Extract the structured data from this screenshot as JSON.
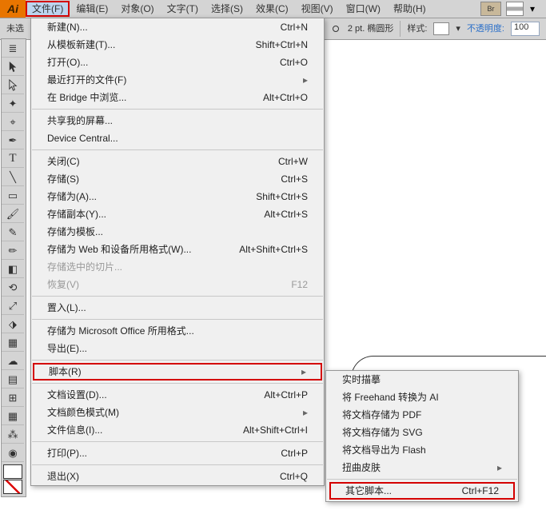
{
  "app": {
    "logo": "Ai"
  },
  "menubar": [
    "文件(F)",
    "编辑(E)",
    "对象(O)",
    "文字(T)",
    "选择(S)",
    "效果(C)",
    "视图(V)",
    "窗口(W)",
    "帮助(H)"
  ],
  "toolbar": {
    "doc_prefix": "未选",
    "stroke_label": "2 pt. 椭圆形",
    "style_label": "样式:",
    "opacity_label": "不透明度:",
    "opacity_value": "100"
  },
  "file_menu": [
    {
      "label": "新建(N)...",
      "sc": "Ctrl+N"
    },
    {
      "label": "从模板新建(T)...",
      "sc": "Shift+Ctrl+N"
    },
    {
      "label": "打开(O)...",
      "sc": "Ctrl+O"
    },
    {
      "label": "最近打开的文件(F)",
      "arrow": true
    },
    {
      "label": "在 Bridge 中浏览...",
      "sc": "Alt+Ctrl+O"
    },
    {
      "div": true
    },
    {
      "label": "共享我的屏幕..."
    },
    {
      "label": "Device Central..."
    },
    {
      "div": true
    },
    {
      "label": "关闭(C)",
      "sc": "Ctrl+W"
    },
    {
      "label": "存储(S)",
      "sc": "Ctrl+S"
    },
    {
      "label": "存储为(A)...",
      "sc": "Shift+Ctrl+S"
    },
    {
      "label": "存储副本(Y)...",
      "sc": "Alt+Ctrl+S"
    },
    {
      "label": "存储为模板..."
    },
    {
      "label": "存储为 Web 和设备所用格式(W)...",
      "sc": "Alt+Shift+Ctrl+S"
    },
    {
      "label": "存储选中的切片...",
      "disabled": true
    },
    {
      "label": "恢复(V)",
      "sc": "F12",
      "disabled": true
    },
    {
      "div": true
    },
    {
      "label": "置入(L)..."
    },
    {
      "div": true
    },
    {
      "label": "存储为 Microsoft Office 所用格式..."
    },
    {
      "label": "导出(E)..."
    },
    {
      "div": true
    },
    {
      "label": "脚本(R)",
      "arrow": true,
      "highlight": true
    },
    {
      "div": true
    },
    {
      "label": "文档设置(D)...",
      "sc": "Alt+Ctrl+P"
    },
    {
      "label": "文档颜色模式(M)",
      "arrow": true
    },
    {
      "label": "文件信息(I)...",
      "sc": "Alt+Shift+Ctrl+I"
    },
    {
      "div": true
    },
    {
      "label": "打印(P)...",
      "sc": "Ctrl+P"
    },
    {
      "div": true
    },
    {
      "label": "退出(X)",
      "sc": "Ctrl+Q"
    }
  ],
  "submenu": [
    {
      "label": "实时描摹"
    },
    {
      "label": "将 Freehand 转换为 AI"
    },
    {
      "label": "将文档存储为 PDF"
    },
    {
      "label": "将文档存储为 SVG"
    },
    {
      "label": "将文档导出为 Flash"
    },
    {
      "label": "扭曲皮肤",
      "arrow": true
    },
    {
      "div": true
    },
    {
      "label": "其它脚本...",
      "sc": "Ctrl+F12",
      "highlight": true
    }
  ]
}
